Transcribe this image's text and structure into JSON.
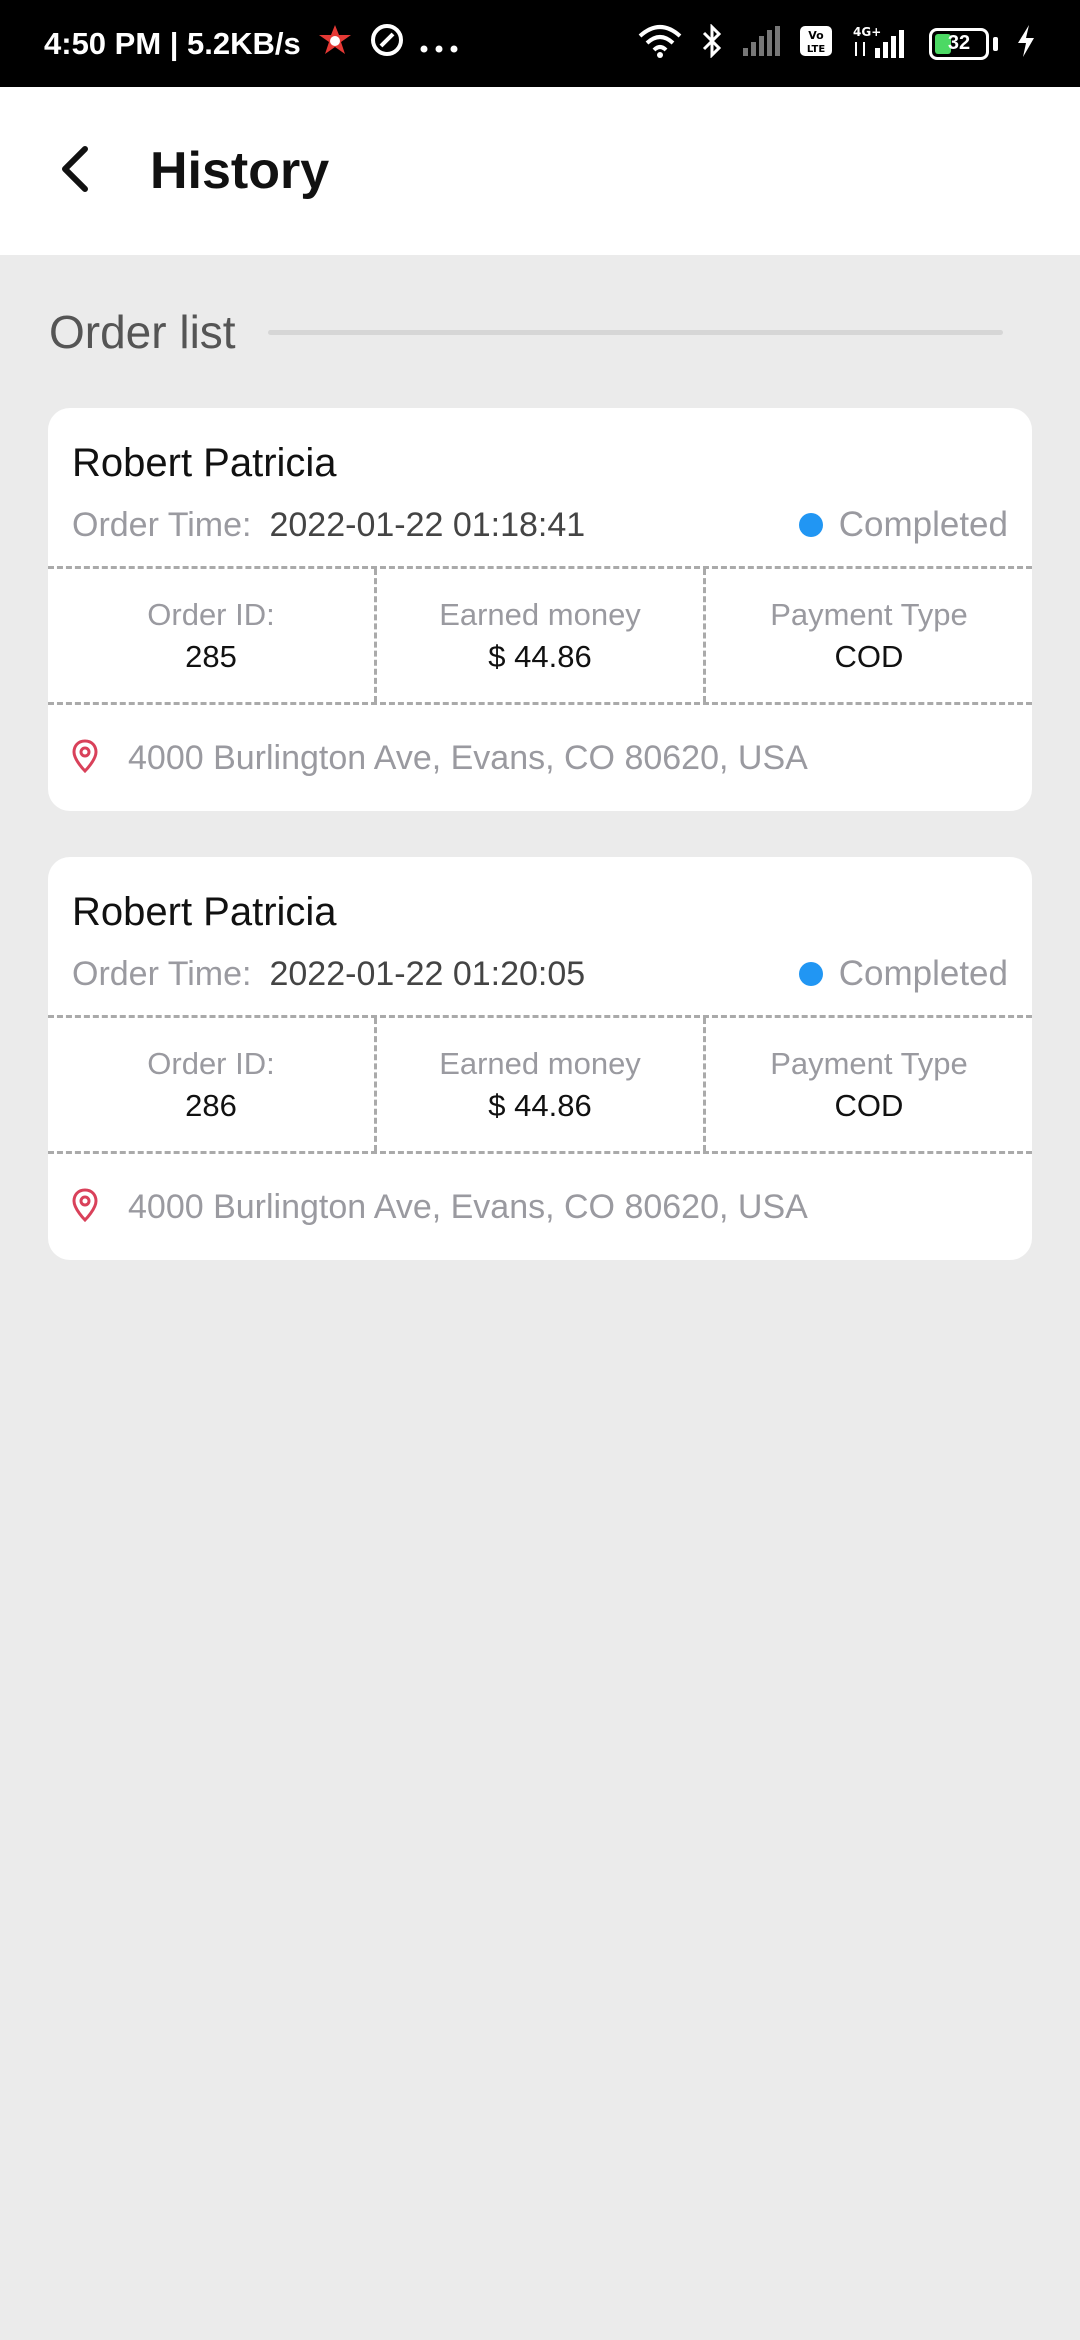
{
  "status_bar": {
    "time_speed": "4:50 PM | 5.2KB/s",
    "battery": "32",
    "icons": [
      "app-notification-icon",
      "media-icon",
      "more-dots-icon",
      "wifi-icon",
      "bluetooth-icon",
      "signal-icon",
      "volte-icon",
      "4g-signal-icon",
      "battery-icon",
      "charging-icon"
    ]
  },
  "header": {
    "title": "History",
    "back_icon": "back-arrow-icon"
  },
  "section": {
    "title": "Order list"
  },
  "orders": [
    {
      "name": "Robert Patricia",
      "time_label": "Order Time:",
      "time_value": "2022-01-22 01:18:41",
      "status": "Completed",
      "status_color": "#2196f3",
      "order_id_label": "Order ID:",
      "order_id": "285",
      "earned_label": "Earned money",
      "earned": "$ 44.86",
      "payment_label": "Payment Type",
      "payment": "COD",
      "address": "4000 Burlington Ave, Evans, CO 80620, USA"
    },
    {
      "name": "Robert Patricia",
      "time_label": "Order Time:",
      "time_value": "2022-01-22 01:20:05",
      "status": "Completed",
      "status_color": "#2196f3",
      "order_id_label": "Order ID:",
      "order_id": "286",
      "earned_label": "Earned money",
      "earned": "$ 44.86",
      "payment_label": "Payment Type",
      "payment": "COD",
      "address": "4000 Burlington Ave, Evans, CO 80620, USA"
    }
  ],
  "colors": {
    "accent": "#2196f3",
    "pin": "#d9415a",
    "background": "#ebebeb"
  }
}
